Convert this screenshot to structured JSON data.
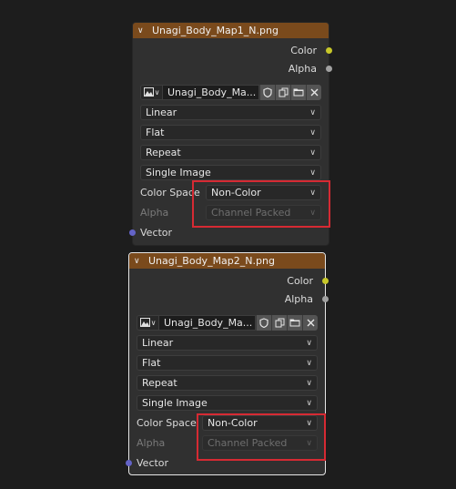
{
  "colors": {
    "header": "#7a4a1c",
    "node_bg": "#303030",
    "socket_color": "#c7c729",
    "socket_alpha": "#a1a1a1",
    "socket_vector": "#6363c7",
    "highlight": "#d62a33"
  },
  "nodes": [
    {
      "title": "Unagi_Body_Map1_N.png",
      "outputs": {
        "color": "Color",
        "alpha": "Alpha"
      },
      "image_name": "Unagi_Body_Ma...",
      "interpolation": "Linear",
      "projection": "Flat",
      "extension": "Repeat",
      "source": "Single Image",
      "color_space_label": "Color Space",
      "color_space_value": "Non-Color",
      "alpha_label": "Alpha",
      "alpha_value": "Channel Packed",
      "input_vector": "Vector",
      "icons": [
        "image-icon",
        "shield-icon",
        "duplicate-icon",
        "folder-icon",
        "close-icon"
      ]
    },
    {
      "title": "Unagi_Body_Map2_N.png",
      "outputs": {
        "color": "Color",
        "alpha": "Alpha"
      },
      "image_name": "Unagi_Body_Ma...",
      "interpolation": "Linear",
      "projection": "Flat",
      "extension": "Repeat",
      "source": "Single Image",
      "color_space_label": "Color Space",
      "color_space_value": "Non-Color",
      "alpha_label": "Alpha",
      "alpha_value": "Channel Packed",
      "input_vector": "Vector",
      "icons": [
        "image-icon",
        "shield-icon",
        "duplicate-icon",
        "folder-icon",
        "close-icon"
      ]
    }
  ]
}
